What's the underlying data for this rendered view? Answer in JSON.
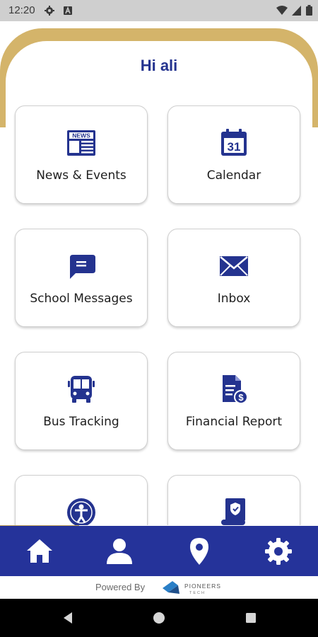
{
  "status_bar": {
    "time": "12:20"
  },
  "greeting": "Hi ali",
  "tiles": [
    {
      "label": "News & Events",
      "icon": "newspaper-icon"
    },
    {
      "label": "Calendar",
      "icon": "calendar-icon"
    },
    {
      "label": "School Messages",
      "icon": "chat-bubble-icon"
    },
    {
      "label": "Inbox",
      "icon": "envelope-icon"
    },
    {
      "label": "Bus Tracking",
      "icon": "bus-icon"
    },
    {
      "label": "Financial Report",
      "icon": "invoice-dollar-icon"
    },
    {
      "label": "",
      "icon": "person-badge-icon"
    },
    {
      "label": "",
      "icon": "certificate-scroll-icon"
    }
  ],
  "calendar_icon_day": "31",
  "news_icon_text": "NEWS",
  "bottom_nav": [
    {
      "name": "home",
      "icon": "home-icon"
    },
    {
      "name": "profile",
      "icon": "user-icon"
    },
    {
      "name": "location",
      "icon": "map-pin-icon"
    },
    {
      "name": "settings",
      "icon": "gear-icon"
    }
  ],
  "footer": {
    "powered_by": "Powered By",
    "brand_name": "PIONEERS",
    "brand_sub": "TECH"
  },
  "colors": {
    "brand_blue": "#24338f",
    "nav_blue": "#25339a",
    "gold": "#d4b46a"
  }
}
